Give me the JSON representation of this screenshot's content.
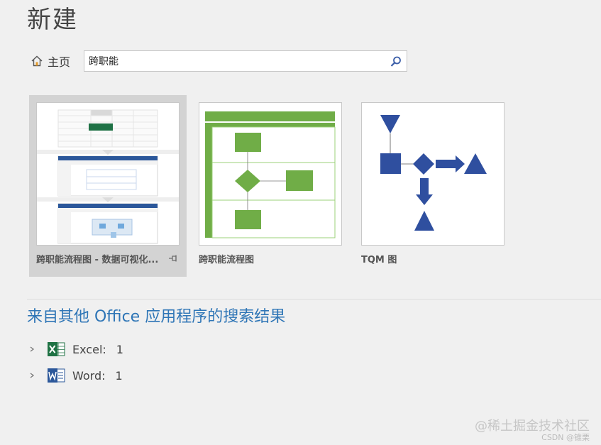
{
  "page": {
    "title": "新建"
  },
  "nav": {
    "home_label": "主页",
    "search_value": "跨职能",
    "search_placeholder": ""
  },
  "templates": [
    {
      "label": "跨职能流程图 - 数据可视化...",
      "selected": true
    },
    {
      "label": "跨职能流程图",
      "selected": false
    },
    {
      "label": "TQM 图",
      "selected": false
    }
  ],
  "other_results": {
    "title": "来自其他 Office 应用程序的搜索结果",
    "apps": [
      {
        "name": "Excel:",
        "count": "1",
        "icon": "excel-icon",
        "color": "#1f7244"
      },
      {
        "name": "Word:",
        "count": "1",
        "icon": "word-icon",
        "color": "#2b579a"
      }
    ]
  },
  "watermark": {
    "text": "@稀土掘金技术社区",
    "sub": "CSDN @锥栗"
  },
  "colors": {
    "accent_blue": "#2e75b6",
    "flow_green": "#70ad47",
    "tqm_blue": "#2f4f9f"
  }
}
